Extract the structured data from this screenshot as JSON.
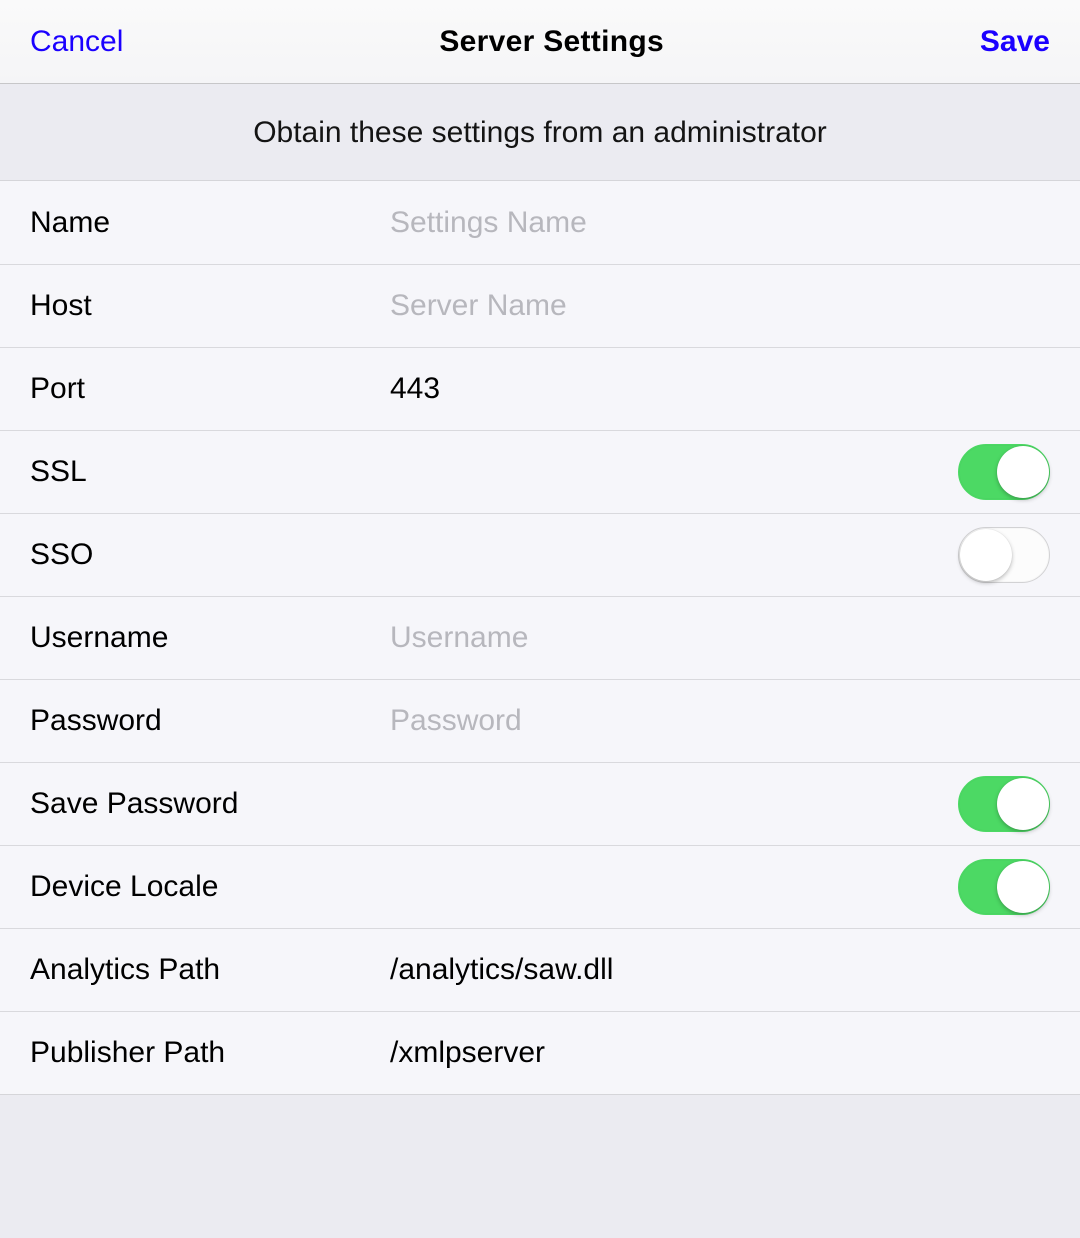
{
  "navbar": {
    "cancel": "Cancel",
    "title": "Server Settings",
    "save": "Save"
  },
  "section_header": "Obtain these settings from an administrator",
  "fields": {
    "name": {
      "label": "Name",
      "placeholder": "Settings Name",
      "value": ""
    },
    "host": {
      "label": "Host",
      "placeholder": "Server Name",
      "value": ""
    },
    "port": {
      "label": "Port",
      "value": "443"
    },
    "ssl": {
      "label": "SSL",
      "on": true
    },
    "sso": {
      "label": "SSO",
      "on": false
    },
    "username": {
      "label": "Username",
      "placeholder": "Username",
      "value": ""
    },
    "password": {
      "label": "Password",
      "placeholder": "Password",
      "value": ""
    },
    "save_password": {
      "label": "Save Password",
      "on": true
    },
    "device_locale": {
      "label": "Device Locale",
      "on": true
    },
    "analytics_path": {
      "label": "Analytics Path",
      "value": "/analytics/saw.dll"
    },
    "publisher_path": {
      "label": "Publisher Path",
      "value": "/xmlpserver"
    }
  }
}
